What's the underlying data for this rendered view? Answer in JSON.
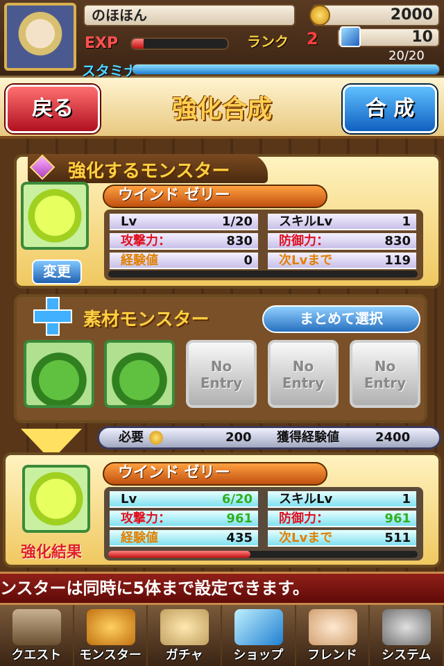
{
  "header": {
    "player_name": "のほほん",
    "coins": "2000",
    "exp_label": "EXP",
    "exp_progress": 0.12,
    "rank_label": "ランク",
    "rank_value": "2",
    "stones": "10",
    "stamina_label": "スタミナ",
    "stamina_count": "20/20",
    "stamina_progress": 1.0
  },
  "toolbar": {
    "back_label": "戻る",
    "title": "強化合成",
    "synth_label": "合 成"
  },
  "base_monster": {
    "section_title": "強化するモンスター",
    "name": "ウインド ゼリー",
    "change_label": "変更",
    "stats": [
      {
        "label": "Lv",
        "value": "1/20"
      },
      {
        "label": "攻撃力：",
        "value": "830"
      },
      {
        "label": "経験値",
        "value": "0"
      },
      {
        "label": "スキルLv",
        "value": "1"
      },
      {
        "label": "防御力：",
        "value": "830"
      },
      {
        "label": "次Lvまで",
        "value": "119"
      }
    ],
    "exp_progress": 0.0
  },
  "materials": {
    "section_title": "素材モンスター",
    "select_all_label": "まとめて選択",
    "slots": [
      {
        "filled": true
      },
      {
        "filled": true
      },
      {
        "filled": false,
        "label": "No\nEntry"
      },
      {
        "filled": false,
        "label": "No\nEntry"
      },
      {
        "filled": false,
        "label": "No\nEntry"
      }
    ],
    "cost_label": "必要",
    "cost_value": "200",
    "gain_label": "獲得経験値",
    "gain_value": "2400"
  },
  "result": {
    "label": "強化結果",
    "name": "ウインド ゼリー",
    "stats": [
      {
        "label": "Lv",
        "value": "6/20"
      },
      {
        "label": "攻撃力：",
        "value": "961"
      },
      {
        "label": "経験値",
        "value": "435"
      },
      {
        "label": "スキルLv",
        "value": "1"
      },
      {
        "label": "防御力：",
        "value": "961"
      },
      {
        "label": "次Lvまで",
        "value": "511"
      }
    ],
    "exp_progress": 0.46
  },
  "ticker": "ンスターは同時に5体まで設定できます。",
  "nav": [
    {
      "label": "クエスト",
      "icon": "quest-icon"
    },
    {
      "label": "モンスター",
      "icon": "monster-icon"
    },
    {
      "label": "ガチャ",
      "icon": "gacha-icon"
    },
    {
      "label": "ショップ",
      "icon": "shop-icon"
    },
    {
      "label": "フレンド",
      "icon": "friend-icon"
    },
    {
      "label": "システム",
      "icon": "system-icon"
    }
  ],
  "colors": {
    "accent_red": "#b01020",
    "accent_blue": "#1060c0",
    "gold": "#ffd050"
  }
}
